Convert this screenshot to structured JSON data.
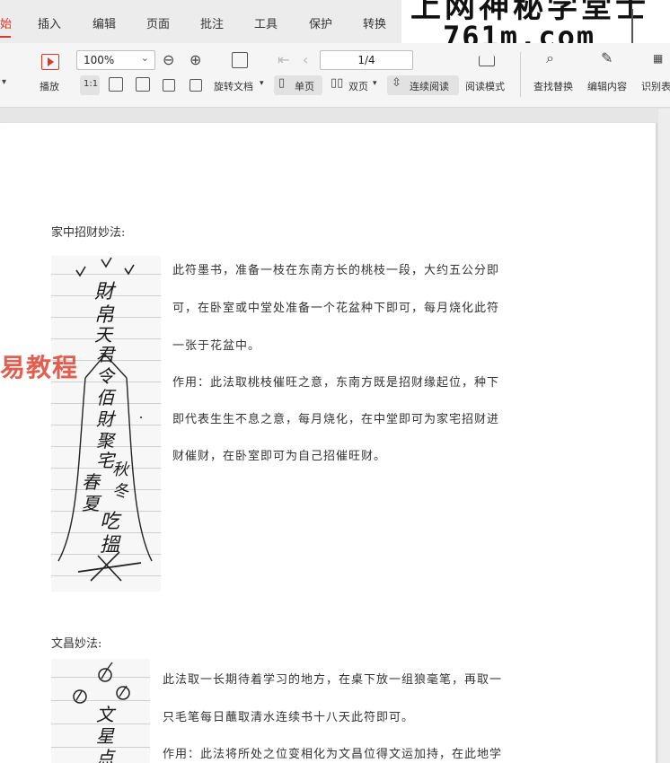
{
  "tabs": [
    {
      "label": "始",
      "active": true
    },
    {
      "label": "插入",
      "active": false
    },
    {
      "label": "编辑",
      "active": false
    },
    {
      "label": "页面",
      "active": false
    },
    {
      "label": "批注",
      "active": false
    },
    {
      "label": "工具",
      "active": false
    },
    {
      "label": "保护",
      "active": false
    },
    {
      "label": "转换",
      "active": false
    }
  ],
  "watermark": {
    "top": "上网神秘学堂士",
    "domain": "761m.com"
  },
  "toolbar": {
    "play_label": "播放",
    "zoom_value": "100%",
    "page_indicator": "1/4",
    "rotate_label": "旋转文档",
    "single_page": "单页",
    "double_page": "双页",
    "continuous": "连续阅读",
    "reading_mode": "阅读模式",
    "find_replace": "查找替换",
    "edit_content": "编辑内容",
    "recognize": "识别表"
  },
  "document": {
    "section1_title": "家中招财妙法:",
    "section1_lines": [
      "此符墨书，准备一枝在东南方长的桃枝一段，大约五公分即",
      "可，在卧室或中堂处准备一个花盆种下即可，每月烧化此符",
      "一张于花盆中。",
      "作用：此法取桃枝催旺之意，东南方既是招财缘起位，种下",
      "即代表生生不息之意，每月烧化，在中堂即可为家宅招财进",
      "财催财，在卧室即可为自己招催旺财。"
    ],
    "talisman1_chars": [
      "財",
      "帛",
      "天",
      "君",
      "令",
      "佰",
      "財",
      "聚",
      "宅",
      "春",
      "夏",
      "秋",
      "冬",
      "吃",
      "搵"
    ],
    "section2_title": "文昌妙法:",
    "section2_lines": [
      "此法取一长期待着学习的地方，在桌下放一组狼毫笔，再取一",
      "只毛笔每日蘸取清水连续书十八天此符即可。",
      "作用：此法将所处之位变相化为文昌位得文运加持，在此地学"
    ],
    "talisman2_chars": [
      "文",
      "星",
      "点"
    ],
    "side_watermark": "易教程"
  }
}
